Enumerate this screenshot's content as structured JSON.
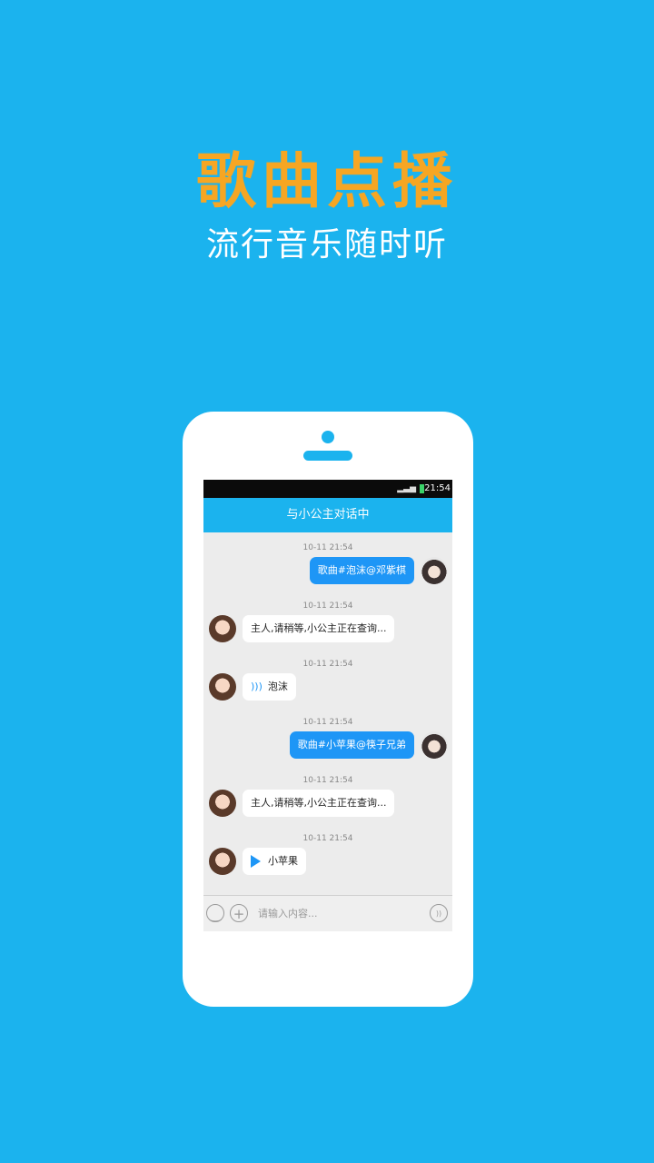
{
  "promo": {
    "title": "歌曲点播",
    "subtitle": "流行音乐随时听"
  },
  "statusbar": {
    "time": "21:54"
  },
  "chat": {
    "header": "与小公主对话中",
    "messages": [
      {
        "time": "10-11 21:54",
        "text": "歌曲#泡沫@邓紫棋"
      },
      {
        "time": "10-11 21:54",
        "text": "主人,请稍等,小公主正在查询..."
      },
      {
        "time": "10-11 21:54",
        "text": "泡沫",
        "icon": "voice-icon"
      },
      {
        "time": "10-11 21:54",
        "text": "歌曲#小苹果@筷子兄弟"
      },
      {
        "time": "10-11 21:54",
        "text": "主人,请稍等,小公主正在查询..."
      },
      {
        "time": "10-11 21:54",
        "text": "小苹果",
        "icon": "play-icon"
      }
    ]
  },
  "input": {
    "placeholder": "请输入内容..."
  },
  "colors": {
    "background": "#1bb3ee",
    "title": "#f6a623",
    "outgoing_bubble": "#1e96f6"
  }
}
